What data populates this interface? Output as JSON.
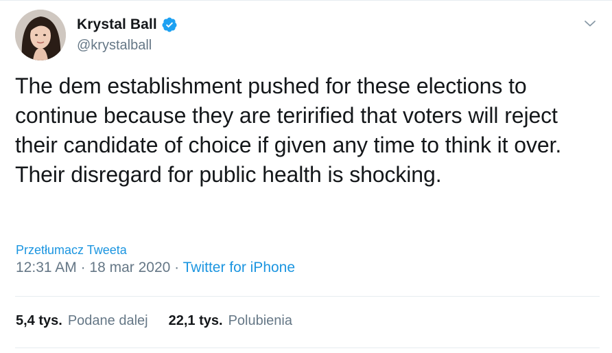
{
  "author": {
    "name": "Krystal Ball",
    "handle": "@krystalball",
    "verified": true
  },
  "tweet": {
    "text": "The dem establishment pushed for these elections to continue because they are terirified that voters will reject their candidate of choice if given any time to think it over. Their disregard for public health is shocking.",
    "translate_label": "Przetłumacz Tweeta",
    "time": "12:31 AM",
    "date": "18 mar 2020",
    "source": "Twitter for iPhone"
  },
  "stats": {
    "retweets_count": "5,4 tys.",
    "retweets_label": "Podane dalej",
    "likes_count": "22,1 tys.",
    "likes_label": "Polubienia"
  },
  "icons": {
    "verified": "verified-badge-icon",
    "menu": "chevron-down-icon"
  },
  "colors": {
    "accent": "#1b95e0",
    "muted": "#657786",
    "text": "#14171a",
    "verified": "#1da1f2",
    "divider": "#e6ecf0"
  }
}
